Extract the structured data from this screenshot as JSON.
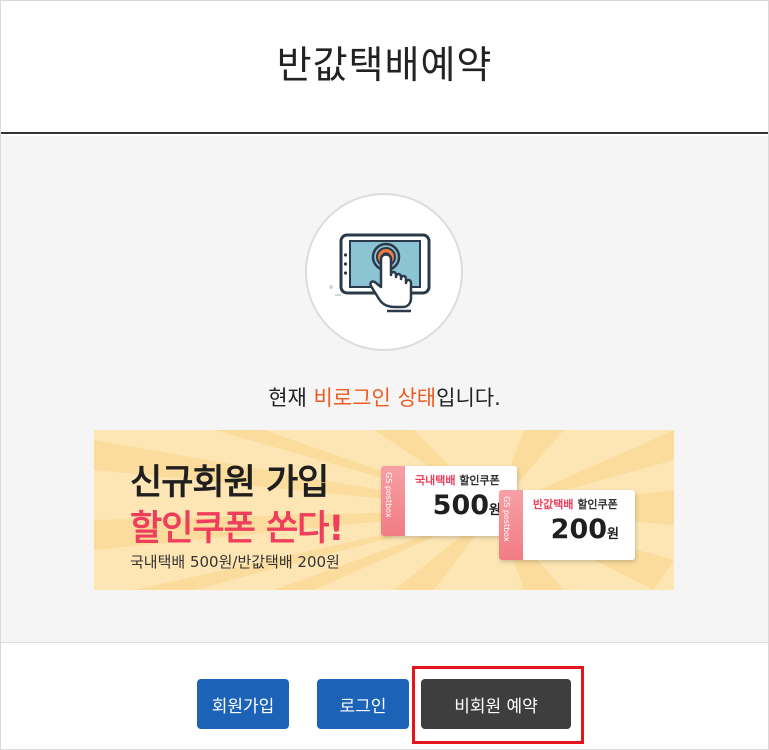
{
  "header": {
    "title": "반값택배예약"
  },
  "status": {
    "prefix": "현재 ",
    "highlight": "비로그인 상태",
    "suffix": "입니다."
  },
  "banner": {
    "headline_line1": "신규회원 가입",
    "headline_line2": "할인쿠폰 쏜다!",
    "subtext": "국내택배 500원/반값택배 200원",
    "coupons": [
      {
        "brand": "GS postbox",
        "type_label": "국내택배",
        "suffix_label": " 할인쿠폰",
        "amount": "500",
        "unit": "원"
      },
      {
        "brand": "GS postbox",
        "type_label": "반값택배",
        "suffix_label": " 할인쿠폰",
        "amount": "200",
        "unit": "원"
      }
    ]
  },
  "buttons": {
    "join_label": "회원가입",
    "login_label": "로그인",
    "guest_label": "비회원 예약"
  },
  "colors": {
    "accent_orange": "#f05a23",
    "primary_blue": "#1c63b7",
    "dark_button": "#3e3e3e",
    "highlight_red": "#e4161c",
    "banner_red": "#ef3e5c"
  }
}
